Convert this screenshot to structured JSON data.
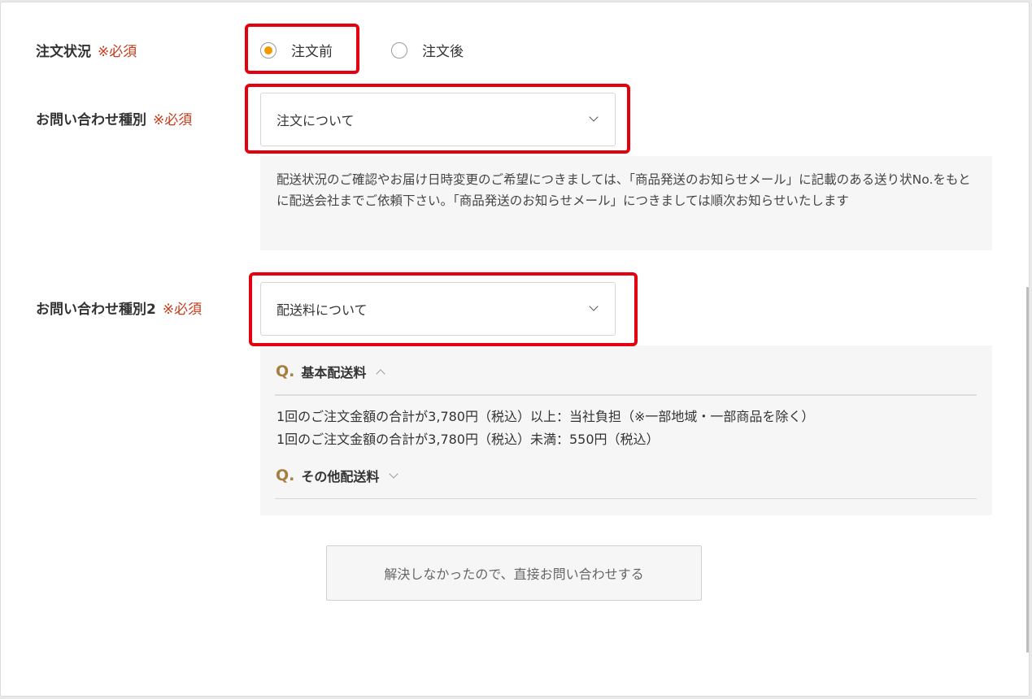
{
  "order_status": {
    "label": "注文状況",
    "required": "※必須",
    "options": [
      {
        "label": "注文前",
        "checked": true
      },
      {
        "label": "注文後",
        "checked": false
      }
    ]
  },
  "inquiry_type": {
    "label": "お問い合わせ種別",
    "required": "※必須",
    "selected": "注文について",
    "note": "配送状況のご確認やお届け日時変更のご希望につきましては、「商品発送のお知らせメール」に記載のある送り状No.をもとに配送会社までご依頼下さい。「商品発送のお知らせメール」につきましては順次お知らせいたします"
  },
  "inquiry_type2": {
    "label": "お問い合わせ種別2",
    "required": "※必須",
    "selected": "配送料について"
  },
  "faq": [
    {
      "q": "Q.",
      "title": "基本配送料",
      "expanded": true,
      "answer_lines": [
        "1回のご注文金額の合計が3,780円（税込）以上：当社負担（※一部地域・一部商品を除く）",
        "1回のご注文金額の合計が3,780円（税込）未満：550円（税込）"
      ]
    },
    {
      "q": "Q.",
      "title": "その他配送料",
      "expanded": false
    }
  ],
  "submit_label": "解決しなかったので、直接お問い合わせする",
  "colors": {
    "highlight": "#e4000f",
    "required": "#c83a1a",
    "radio_accent": "#f39800",
    "faq_q": "#a57f3f"
  }
}
